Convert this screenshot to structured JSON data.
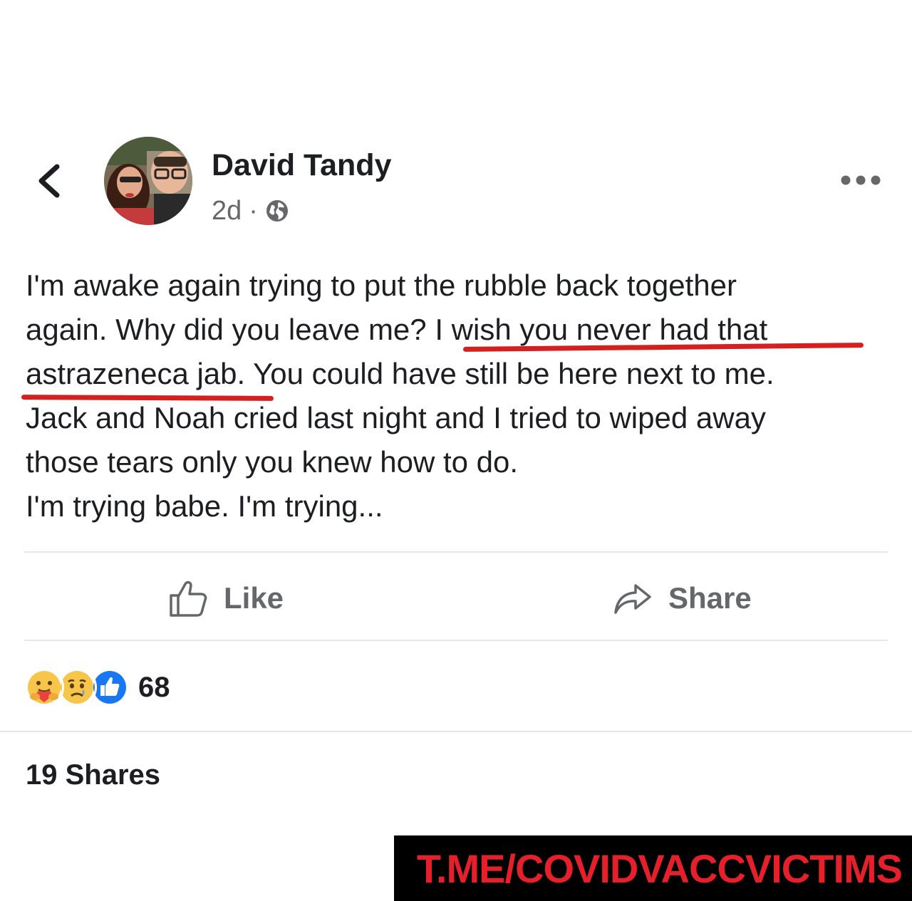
{
  "post": {
    "author_name": "David Tandy",
    "time": "2d",
    "separator": "·",
    "privacy_icon": "globe-icon",
    "body_lines": [
      "I'm awake again trying to put the rubble back together",
      "again. Why did you leave me? I wish you never had that",
      "astrazeneca jab. You could have still be here next to me.",
      "Jack and Noah cried last night and I tried to wiped away",
      "those tears only you knew how to do.",
      "I'm trying babe. I'm trying..."
    ],
    "highlight_color": "#d6201f"
  },
  "actions": {
    "like_label": "Like",
    "share_label": "Share"
  },
  "reactions": {
    "icons": [
      "care-icon",
      "sad-icon",
      "like-icon"
    ],
    "count": "68"
  },
  "shares": {
    "label": "19 Shares"
  },
  "watermark": {
    "text": "T.ME/COVIDVACCVICTIMS",
    "text_color": "#e5202a",
    "background": "#000000"
  }
}
